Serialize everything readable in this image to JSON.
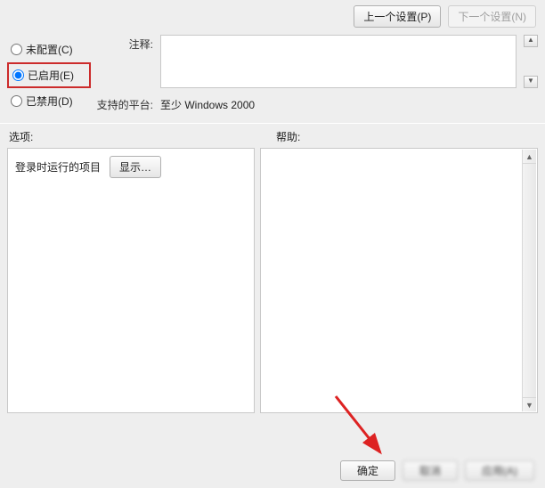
{
  "topbar": {
    "prev_label": "上一个设置(P)",
    "next_label": "下一个设置(N)"
  },
  "radios": {
    "not_configured": "未配置(C)",
    "enabled": "已启用(E)",
    "disabled": "已禁用(D)",
    "selected": "enabled"
  },
  "comment": {
    "label": "注释:",
    "value": ""
  },
  "platform": {
    "label": "支持的平台:",
    "value": "至少 Windows 2000"
  },
  "sections": {
    "options_label": "选项:",
    "help_label": "帮助:"
  },
  "options": {
    "item_label": "登录时运行的项目",
    "show_button": "显示…"
  },
  "help": {
    "text": ""
  },
  "buttons": {
    "ok": "确定",
    "cancel": "取消",
    "apply": "应用(A)"
  }
}
